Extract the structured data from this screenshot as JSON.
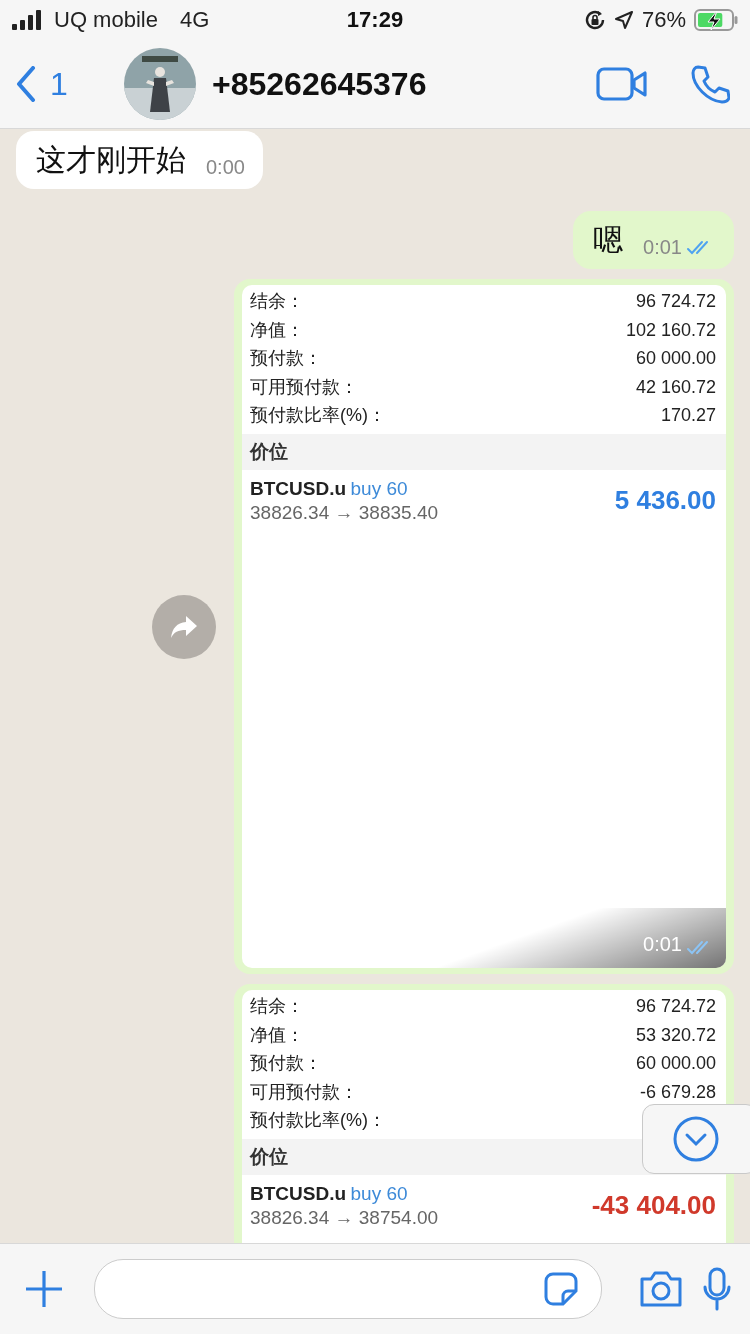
{
  "status_bar": {
    "carrier": "UQ mobile",
    "network": "4G",
    "time": "17:29",
    "battery": "76%",
    "charging": true
  },
  "header": {
    "back_count": "1",
    "title": "+85262645376"
  },
  "messages": [
    {
      "kind": "incoming_text",
      "text": "这才刚开始",
      "time": "0:00"
    },
    {
      "kind": "outgoing_text",
      "text": "嗯",
      "time": "0:01",
      "read": true
    },
    {
      "time": "0:01",
      "read": true,
      "forward": true,
      "shot": {
        "rows": [
          {
            "label": "结余：",
            "value": "96 724.72"
          },
          {
            "label": "净值：",
            "value": "102 160.72"
          },
          {
            "label": "预付款：",
            "value": "60 000.00"
          },
          {
            "label": "可用预付款：",
            "value": "42 160.72"
          },
          {
            "label": "预付款比率(%)：",
            "value": "170.27"
          }
        ],
        "section": "价位",
        "position": {
          "symbol": "BTCUSD.u",
          "order": "buy 60",
          "prices": "38826.34 → 38835.40",
          "profit": "5 436.00",
          "kind": "gain"
        }
      }
    },
    {
      "shot": {
        "rows": [
          {
            "label": "结余：",
            "value": "96 724.72"
          },
          {
            "label": "净值：",
            "value": "53 320.72"
          },
          {
            "label": "预付款：",
            "value": "60 000.00"
          },
          {
            "label": "可用预付款：",
            "value": "-6 679.28"
          },
          {
            "label": "预付款比率(%)："
          }
        ],
        "section": "价位",
        "position": {
          "symbol": "BTCUSD.u",
          "order": "buy 60",
          "prices": "38826.34 → 38754.00",
          "profit": "-43 404.00",
          "kind": "loss"
        }
      }
    }
  ],
  "scroll_down_button": true
}
